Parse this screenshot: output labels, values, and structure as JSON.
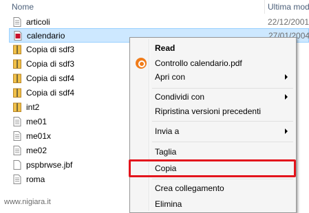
{
  "header": {
    "name_col": "Nome",
    "date_col": "Ultima mod"
  },
  "files": [
    {
      "name": "articoli",
      "date": "22/12/2001",
      "icon": "text-file-icon"
    },
    {
      "name": "calendario",
      "date": "27/01/2004",
      "icon": "pdf-file-icon",
      "selected": true
    },
    {
      "name": "Copia di sdf3",
      "date": "",
      "icon": "zip-folder-icon"
    },
    {
      "name": "Copia di sdf3",
      "date": "",
      "icon": "zip-folder-icon"
    },
    {
      "name": "Copia di sdf4",
      "date": "",
      "icon": "zip-folder-icon"
    },
    {
      "name": "Copia di sdf4",
      "date": "",
      "icon": "zip-folder-icon"
    },
    {
      "name": "int2",
      "date": "003",
      "icon": "zip-folder-icon"
    },
    {
      "name": "me01",
      "date": "003",
      "icon": "text-file-icon"
    },
    {
      "name": "me01x",
      "date": "003",
      "icon": "text-file-icon"
    },
    {
      "name": "me02",
      "date": "003",
      "icon": "text-file-icon"
    },
    {
      "name": "pspbrwse.jbf",
      "date": "003",
      "icon": "blank-file-icon"
    },
    {
      "name": "roma",
      "date": "002",
      "icon": "text-file-icon"
    }
  ],
  "menu": {
    "read": "Read",
    "controllo": "Controllo calendario.pdf",
    "apri_con": "Apri con",
    "condividi": "Condividi con",
    "ripristina": "Ripristina versioni precedenti",
    "invia": "Invia a",
    "taglia": "Taglia",
    "copia": "Copia",
    "crea": "Crea collegamento",
    "elimina": "Elimina"
  },
  "watermark": "www.nigiara.it",
  "colors": {
    "highlight_border": "#e3141c",
    "selection": "#cde8ff"
  }
}
